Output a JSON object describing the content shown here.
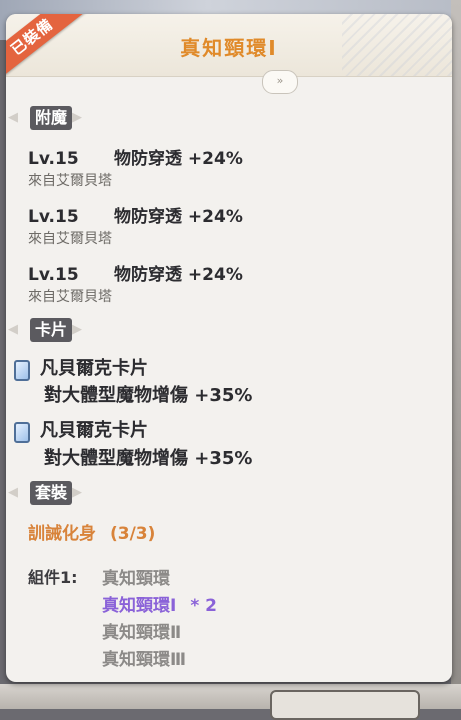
{
  "item": {
    "title": "真知頸環Ⅰ",
    "equipped_badge": "已裝備"
  },
  "sections": {
    "enchant_label": "附魔",
    "card_label": "卡片",
    "set_label": "套裝"
  },
  "enchantments": [
    {
      "level": "Lv.15",
      "stat": "物防穿透 +24%",
      "source": "來自艾爾貝塔"
    },
    {
      "level": "Lv.15",
      "stat": "物防穿透 +24%",
      "source": "來自艾爾貝塔"
    },
    {
      "level": "Lv.15",
      "stat": "物防穿透 +24%",
      "source": "來自艾爾貝塔"
    }
  ],
  "cards": [
    {
      "name": "凡貝爾克卡片",
      "effect": "對大體型魔物增傷 +35%"
    },
    {
      "name": "凡貝爾克卡片",
      "effect": "對大體型魔物增傷 +35%"
    }
  ],
  "set": {
    "name": "訓誡化身",
    "count": "(3/3)",
    "components_prefix": "組件1:",
    "components": [
      {
        "name": "真知頸環",
        "state": "dim",
        "mult": ""
      },
      {
        "name": "真知頸環Ⅰ",
        "state": "active",
        "mult": "* 2"
      },
      {
        "name": "真知頸環Ⅱ",
        "state": "dim",
        "mult": ""
      },
      {
        "name": "真知頸環Ⅲ",
        "state": "dim",
        "mult": ""
      }
    ]
  },
  "colors": {
    "title": "#e08a2a",
    "set_name": "#d8833a",
    "active_component": "#8a62d8",
    "section_label_bg": "#5b5a5f",
    "ribbon": "#e4643f"
  }
}
